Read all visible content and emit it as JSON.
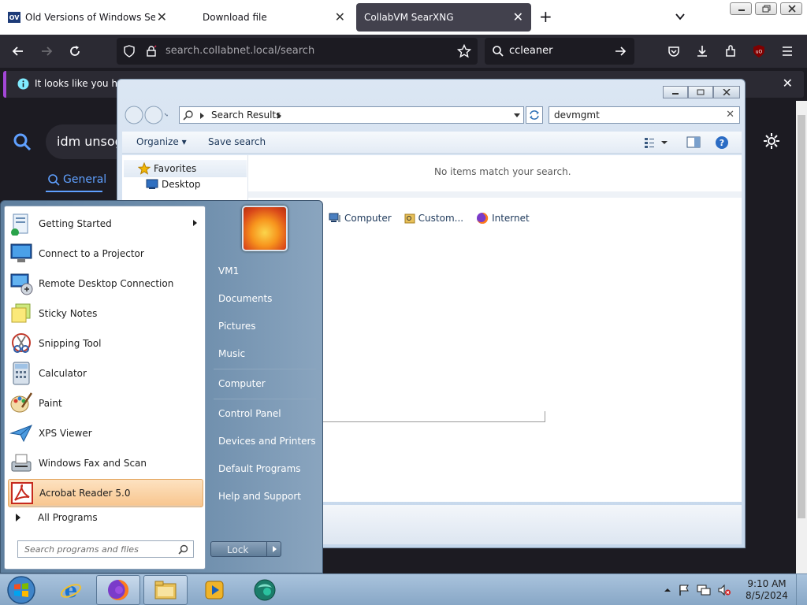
{
  "browser": {
    "tabs": [
      {
        "label": "Old Versions of Windows Secur",
        "favicon": "OV"
      },
      {
        "label": "Download file"
      },
      {
        "label": "CollabVM SearXNG"
      }
    ],
    "url": "search.collabnet.local/search",
    "search_value": "ccleaner",
    "infobar_text": "It looks like you hav",
    "page": {
      "search_query": "idm unsog",
      "general_tab": "General"
    }
  },
  "explorer": {
    "address_crumb": "Search Results",
    "search_value": "devmgmt",
    "toolbar": {
      "organize": "Organize",
      "save_search": "Save search"
    },
    "nav": {
      "favorites": "Favorites",
      "desktop": "Desktop"
    },
    "no_items": "No items match your search.",
    "search_again": [
      {
        "label": "Computer"
      },
      {
        "label": "Custom..."
      },
      {
        "label": "Internet"
      }
    ]
  },
  "start_menu": {
    "programs": [
      {
        "label": "Getting Started",
        "icon": "getting-started-icon"
      },
      {
        "label": "Connect to a Projector",
        "icon": "projector-icon"
      },
      {
        "label": "Remote Desktop Connection",
        "icon": "remote-desktop-icon"
      },
      {
        "label": "Sticky Notes",
        "icon": "sticky-notes-icon"
      },
      {
        "label": "Snipping Tool",
        "icon": "snipping-tool-icon"
      },
      {
        "label": "Calculator",
        "icon": "calculator-icon"
      },
      {
        "label": "Paint",
        "icon": "paint-icon"
      },
      {
        "label": "XPS Viewer",
        "icon": "xps-viewer-icon"
      },
      {
        "label": "Windows Fax and Scan",
        "icon": "fax-scan-icon"
      },
      {
        "label": "Acrobat Reader 5.0",
        "icon": "acrobat-icon"
      }
    ],
    "all_programs": "All Programs",
    "search_placeholder": "Search programs and files",
    "right": [
      "VM1",
      "Documents",
      "Pictures",
      "Music",
      "Computer",
      "Control Panel",
      "Devices and Printers",
      "Default Programs",
      "Help and Support"
    ],
    "lock_label": "Lock"
  },
  "taskbar": {
    "time": "9:10 AM",
    "date": "8/5/2024"
  }
}
